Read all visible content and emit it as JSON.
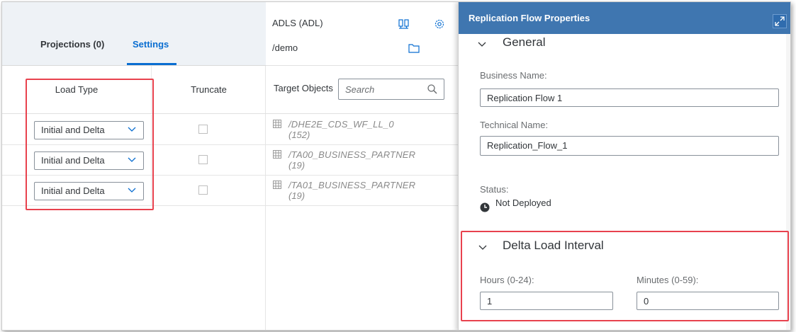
{
  "tabs": {
    "projections": "Projections (0)",
    "settings": "Settings"
  },
  "settings_table": {
    "col_load_type": "Load Type",
    "col_truncate": "Truncate",
    "rows": [
      {
        "load_type": "Initial and Delta",
        "truncate": false
      },
      {
        "load_type": "Initial and Delta",
        "truncate": false
      },
      {
        "load_type": "Initial and Delta",
        "truncate": false
      }
    ]
  },
  "target": {
    "connection": "ADLS (ADL)",
    "path": "/demo",
    "objects_label": "Target Objects",
    "search_placeholder": "Search",
    "objects": [
      {
        "name": "/DHE2E_CDS_WF_LL_0",
        "count": "(152)"
      },
      {
        "name": "/TA00_BUSINESS_PARTNER",
        "count": "(19)"
      },
      {
        "name": "/TA01_BUSINESS_PARTNER",
        "count": "(19)"
      }
    ]
  },
  "panel": {
    "title": "Replication Flow Properties",
    "general": {
      "title": "General",
      "business_name_label": "Business Name:",
      "business_name": "Replication Flow 1",
      "technical_name_label": "Technical Name:",
      "technical_name": "Replication_Flow_1",
      "status_label": "Status:",
      "status": "Not Deployed"
    },
    "delta": {
      "title": "Delta Load Interval",
      "hours_label": "Hours (0-24):",
      "hours": "1",
      "minutes_label": "Minutes (0-59):",
      "minutes": "0"
    }
  },
  "colors": {
    "panel_header": "#3f76b0",
    "tab_active": "#0a6ed1",
    "highlight": "#e8424e"
  }
}
